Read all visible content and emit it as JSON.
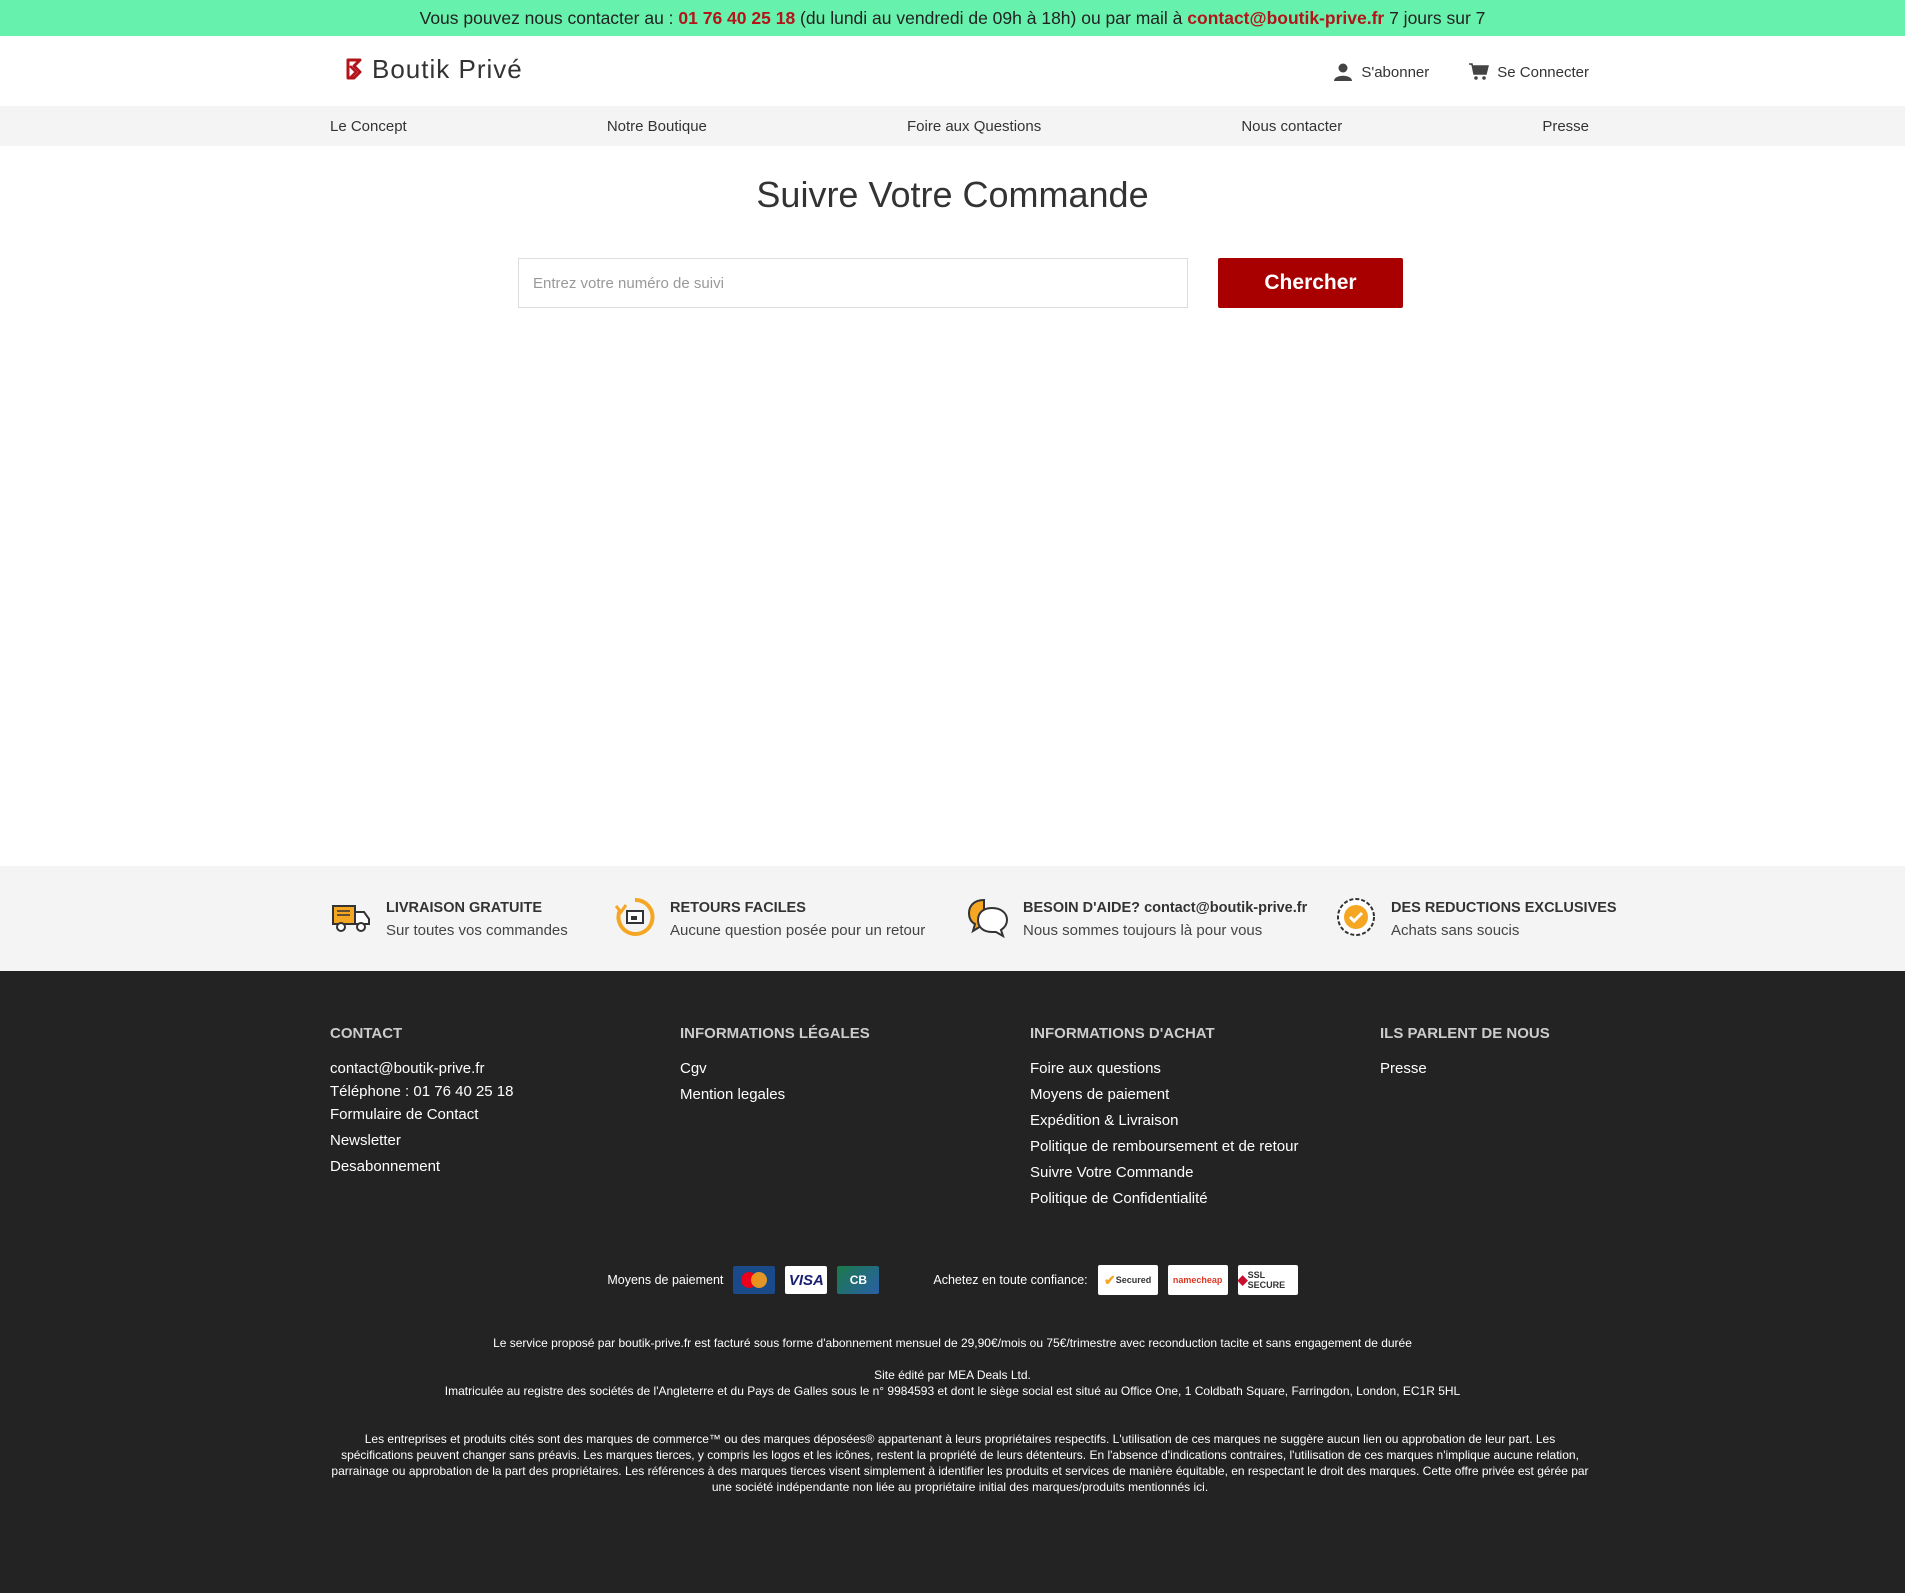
{
  "topbar": {
    "prefix": "Vous pouvez nous contacter au : ",
    "phone": "01 76 40 25 18",
    "middle": " (du lundi au vendredi de 09h à 18h) ou par mail à ",
    "email": "contact@boutik-prive.fr",
    "suffix": " 7 jours sur 7"
  },
  "header": {
    "logo_text": "Boutik Privé",
    "subscribe_label": "S'abonner",
    "login_label": "Se Connecter"
  },
  "nav": {
    "items": [
      "Le Concept",
      "Notre Boutique",
      "Foire aux Questions",
      "Nous contacter",
      "Presse"
    ]
  },
  "main": {
    "title": "Suivre Votre Commande",
    "search_placeholder": "Entrez votre numéro de suivi",
    "search_button": "Chercher"
  },
  "features": [
    {
      "icon": "truck-icon",
      "title": "LIVRAISON GRATUITE",
      "subtitle": "Sur toutes vos commandes"
    },
    {
      "icon": "return-icon",
      "title": "RETOURS FACILES",
      "subtitle": "Aucune question posée pour un retour"
    },
    {
      "icon": "chat-icon",
      "title": "BESOIN D'AIDE? contact@boutik-prive.fr",
      "subtitle": "Nous sommes toujours là pour vous"
    },
    {
      "icon": "badge-check-icon",
      "title": "DES REDUCTIONS EXCLUSIVES",
      "subtitle": "Achats sans soucis"
    }
  ],
  "footer": {
    "columns": [
      {
        "title": "CONTACT",
        "links": [
          "contact@boutik-prive.fr",
          "Téléphone : 01 76 40 25 18",
          "Formulaire de Contact",
          "Newsletter",
          "Desabonnement"
        ]
      },
      {
        "title": "INFORMATIONS LÉGALES",
        "links": [
          "Cgv",
          "Mention legales"
        ]
      },
      {
        "title": "INFORMATIONS D'ACHAT",
        "links": [
          "Foire aux questions",
          "Moyens de paiement",
          "Expédition & Livraison",
          "Politique de remboursement et de retour",
          "Suivre Votre Commande",
          "Politique de Confidentialité"
        ]
      },
      {
        "title": "ILS PARLENT DE NOUS",
        "links": [
          "Presse"
        ]
      }
    ],
    "payment_label": "Moyens de paiement",
    "cards": [
      "MasterCard",
      "VISA",
      "CB"
    ],
    "trust_label": "Achetez en toute confiance:",
    "trust_badges": [
      "Secured",
      "namecheap",
      "SSL SECURE"
    ],
    "legal_1": "Le service proposé par boutik-prive.fr est facturé sous forme d'abonnement mensuel de 29,90€/mois ou 75€/trimestre avec reconduction tacite et sans engagement de durée",
    "legal_2": "Site édité par MEA Deals Ltd.",
    "legal_3": "Imatriculée au registre des sociétés de l'Angleterre et du Pays de Galles sous le n° 9984593 et dont le siège social est situé au Office One, 1 Coldbath Square, Farringdon, London, EC1R 5HL",
    "legal_4": "Les entreprises et produits cités sont des marques de commerce™ ou des marques déposées® appartenant à leurs propriétaires respectifs. L'utilisation de ces marques ne suggère aucun lien ou approbation de leur part. Les spécifications peuvent changer sans préavis. Les marques tierces, y compris les logos et les icônes, restent la propriété de leurs détenteurs. En l'absence d'indications contraires, l'utilisation de ces marques n'implique aucune relation, parrainage ou approbation de la part des propriétaires. Les références à des marques tierces visent simplement à identifier les produits et services de manière équitable, en respectant le droit des marques. Cette offre privée est gérée par une société indépendante non liée au propriétaire initial des marques/produits mentionnés ici."
  },
  "colors": {
    "topbar_bg": "#66f2ac",
    "accent_red": "#a80000",
    "footer_bg": "#232323",
    "feature_orange": "#f5a623"
  }
}
